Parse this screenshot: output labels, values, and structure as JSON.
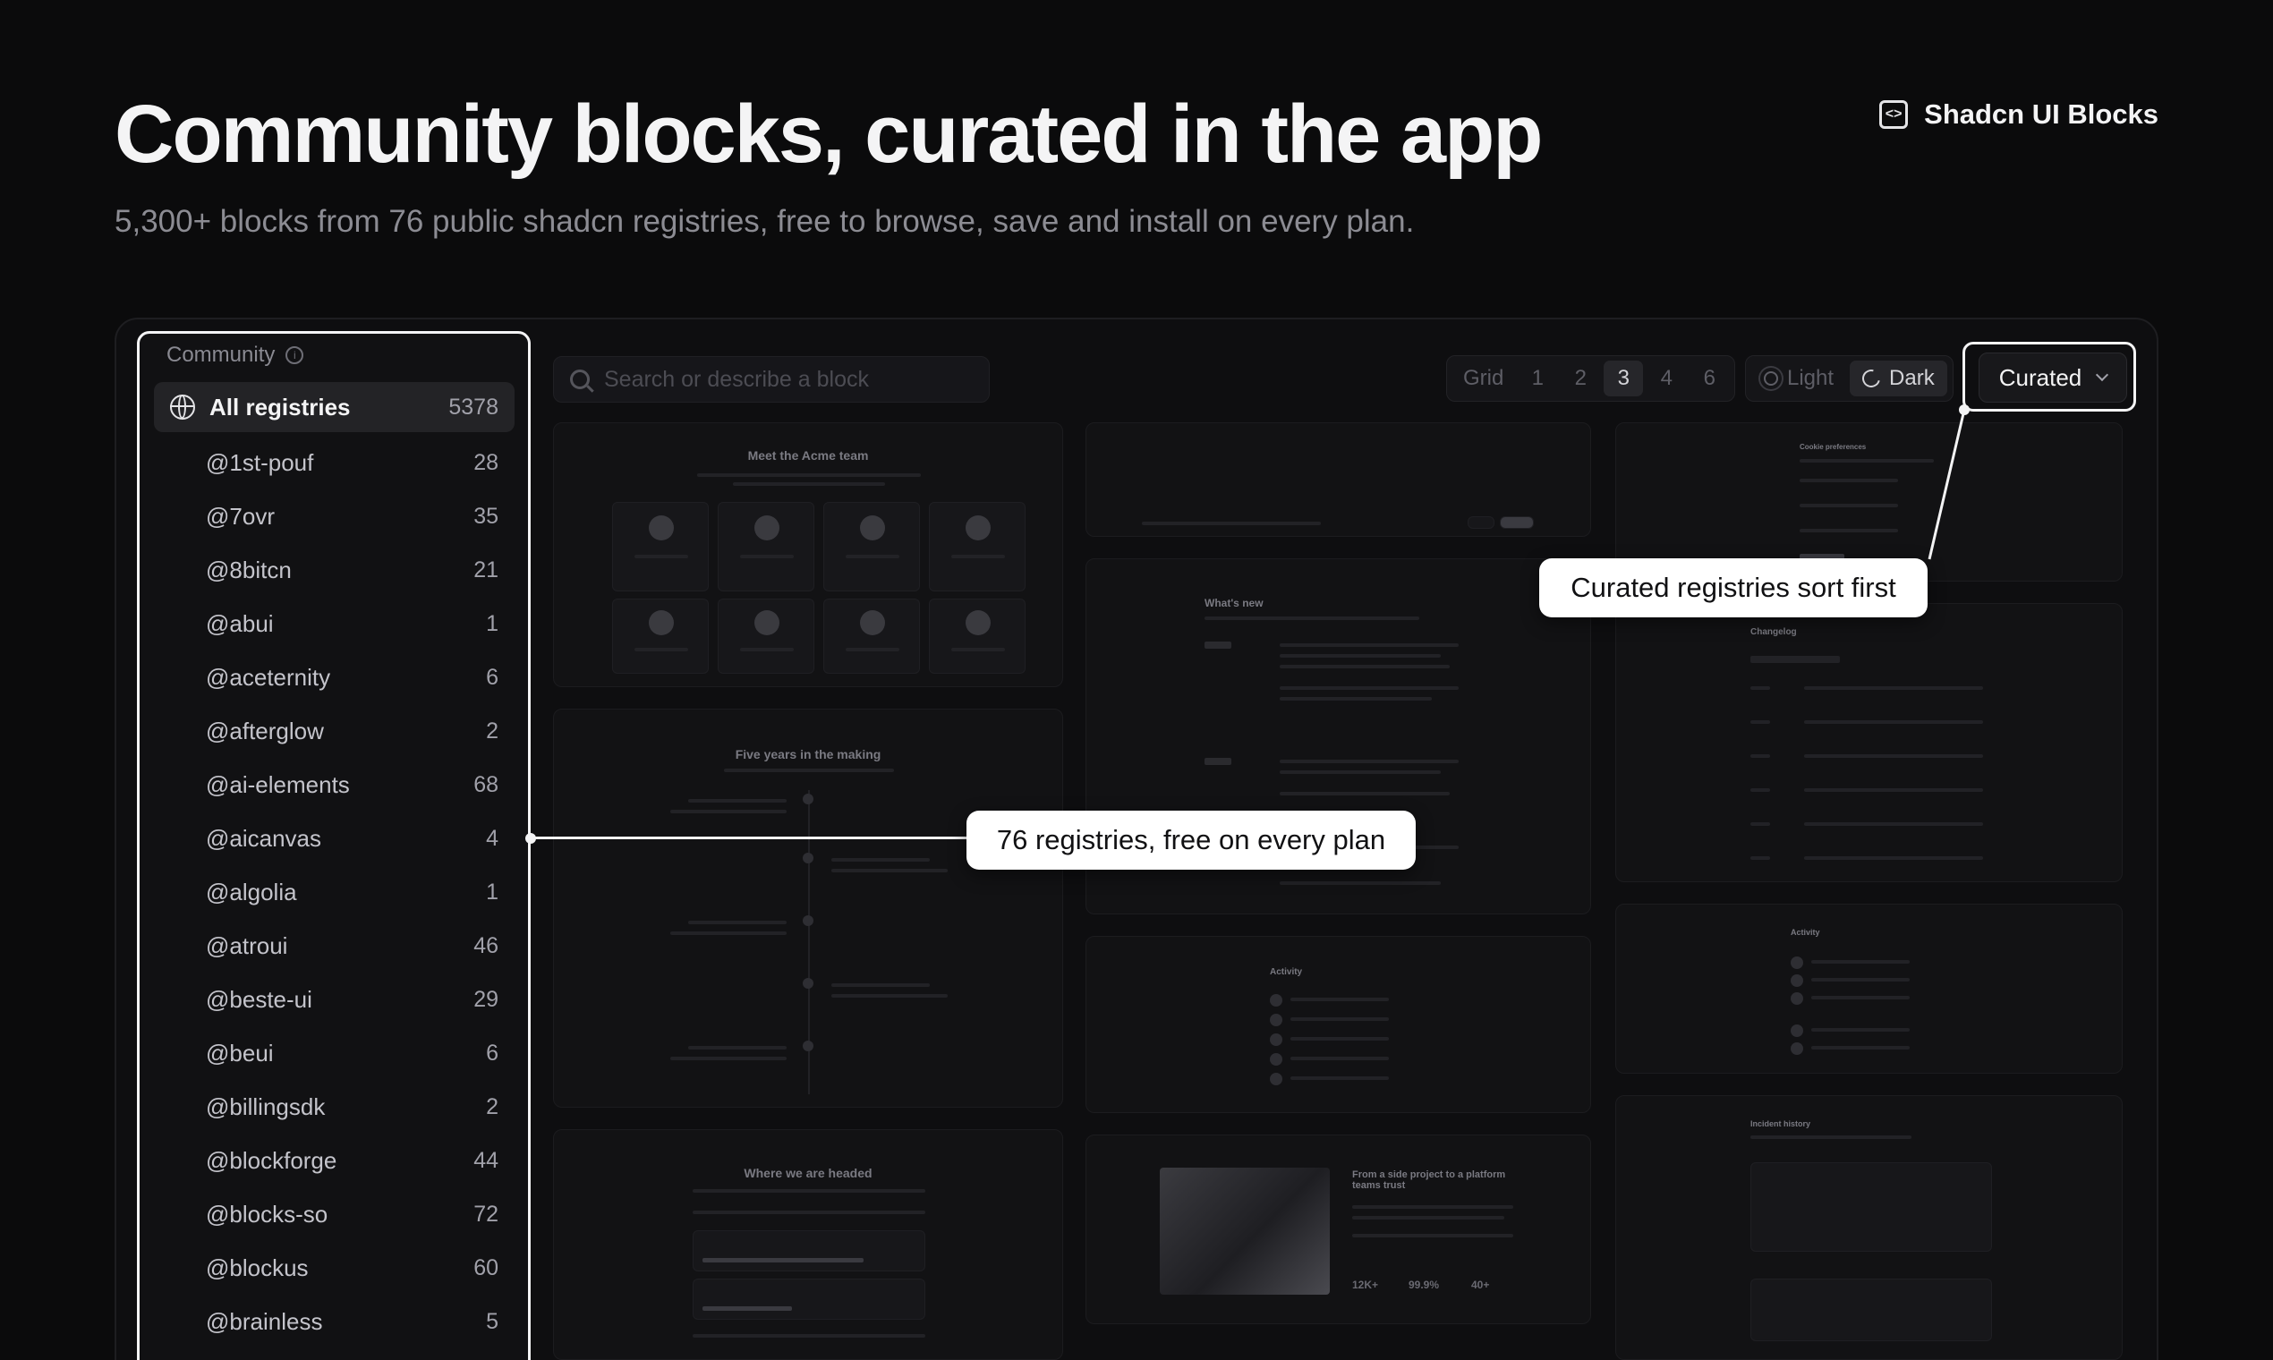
{
  "hero": {
    "title": "Community blocks, curated in the app",
    "subtitle": "5,300+ blocks from 76 public shadcn registries, free to browse, save and install on every plan."
  },
  "brand": {
    "label": "Shadcn UI Blocks",
    "icon": "code-square-icon"
  },
  "sidebar": {
    "heading": "Community",
    "all": {
      "label": "All registries",
      "count": "5378"
    },
    "items": [
      {
        "label": "@1st-pouf",
        "count": "28"
      },
      {
        "label": "@7ovr",
        "count": "35"
      },
      {
        "label": "@8bitcn",
        "count": "21"
      },
      {
        "label": "@abui",
        "count": "1"
      },
      {
        "label": "@aceternity",
        "count": "6"
      },
      {
        "label": "@afterglow",
        "count": "2"
      },
      {
        "label": "@ai-elements",
        "count": "68"
      },
      {
        "label": "@aicanvas",
        "count": "4"
      },
      {
        "label": "@algolia",
        "count": "1"
      },
      {
        "label": "@atroui",
        "count": "46"
      },
      {
        "label": "@beste-ui",
        "count": "29"
      },
      {
        "label": "@beui",
        "count": "6"
      },
      {
        "label": "@billingsdk",
        "count": "2"
      },
      {
        "label": "@blockforge",
        "count": "44"
      },
      {
        "label": "@blocks-so",
        "count": "72"
      },
      {
        "label": "@blockus",
        "count": "60"
      },
      {
        "label": "@brainless",
        "count": "5"
      }
    ]
  },
  "toolbar": {
    "search_placeholder": "Search or describe a block",
    "grid_label": "Grid",
    "grid_options": [
      "1",
      "2",
      "3",
      "4",
      "6"
    ],
    "grid_selected": "3",
    "theme_light": "Light",
    "theme_dark": "Dark",
    "sort_label": "Curated"
  },
  "cards": {
    "team_title": "Meet the Acme team",
    "whats_new_title": "What's new",
    "cookie_title": "Cookie preferences",
    "changelog_title": "Changelog",
    "timeline_title": "Five years in the making",
    "activity_title": "Activity",
    "activity_title_2": "Activity",
    "roadmap_title": "Where we are headed",
    "story_title": "From a side project to a platform teams trust",
    "incident_title": "Incident history",
    "story_stats": [
      "12K+",
      "99.9%",
      "40+"
    ]
  },
  "callouts": {
    "registries": "76 registries, free on every plan",
    "curated": "Curated registries sort first"
  },
  "colors": {
    "background": "#0b0b0c",
    "callout_bg": "#ffffff",
    "highlight": "#f4f4f5"
  }
}
